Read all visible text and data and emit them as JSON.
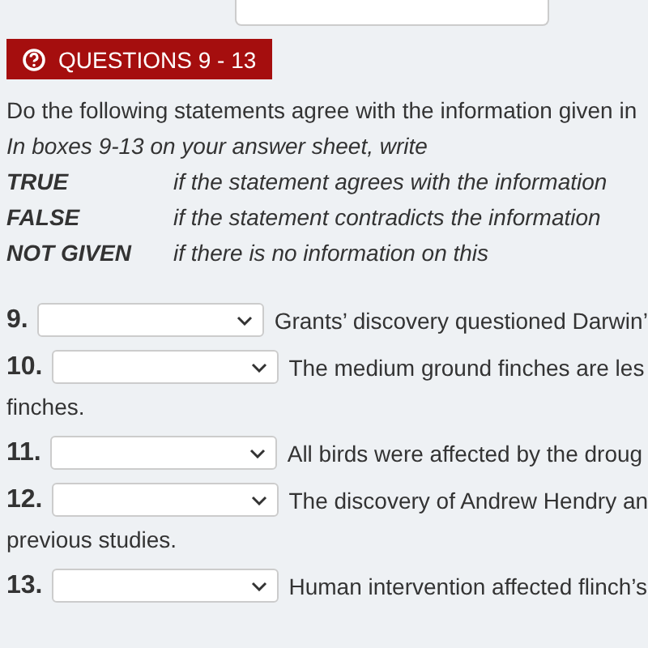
{
  "header": {
    "title": "QUESTIONS 9 - 13"
  },
  "instructions": {
    "lead": "Do the following statements agree with the information given in",
    "note": "In boxes 9-13 on your answer sheet, write",
    "options": [
      {
        "label": "TRUE",
        "meaning": "if the statement agrees with the information"
      },
      {
        "label": "FALSE",
        "meaning": "if the statement contradicts the information"
      },
      {
        "label": "NOT GIVEN",
        "meaning": "if there is no information on this"
      }
    ]
  },
  "questions": [
    {
      "number": "9.",
      "text": "Grants’ discovery questioned Darwin’"
    },
    {
      "number": "10.",
      "text": "The medium ground finches are les",
      "continuation": "finches."
    },
    {
      "number": "11.",
      "text": "All birds were affected by the droug"
    },
    {
      "number": "12.",
      "text": "The discovery of Andrew Hendry an",
      "continuation": "previous studies."
    },
    {
      "number": "13.",
      "text": "Human intervention affected flinch’s"
    }
  ]
}
